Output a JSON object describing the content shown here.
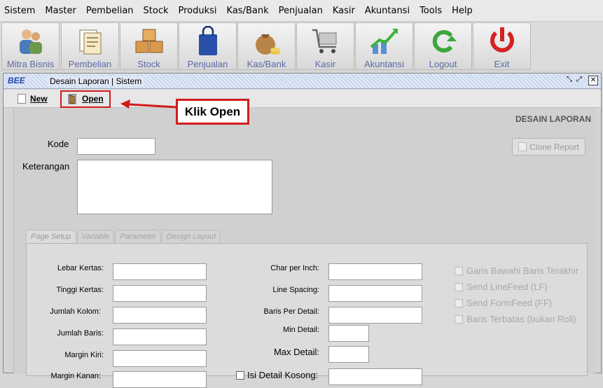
{
  "menubar": [
    "Sistem",
    "Master",
    "Pembelian",
    "Stock",
    "Produksi",
    "Kas/Bank",
    "Penjualan",
    "Kasir",
    "Akuntansi",
    "Tools",
    "Help"
  ],
  "toolbar": [
    {
      "label": "Mitra Bisnis",
      "icon": "people-icon"
    },
    {
      "label": "Pembelian",
      "icon": "documents-icon"
    },
    {
      "label": "Stock",
      "icon": "boxes-icon"
    },
    {
      "label": "Penjualan",
      "icon": "shopping-bag-icon"
    },
    {
      "label": "Kas/Bank",
      "icon": "money-bag-icon"
    },
    {
      "label": "Kasir",
      "icon": "cart-icon"
    },
    {
      "label": "Akuntansi",
      "icon": "chart-up-icon"
    },
    {
      "label": "Logout",
      "icon": "refresh-arrow-icon"
    },
    {
      "label": "Exit",
      "icon": "power-icon"
    }
  ],
  "window": {
    "logo": "BEE",
    "title": "Desain Laporan | Sistem"
  },
  "subbar": {
    "new_label": "New",
    "open_label": "Open"
  },
  "callout": "Klik Open",
  "panel": {
    "title": "DESAIN LAPORAN",
    "kode_label": "Kode",
    "keterangan_label": "Keterangan",
    "clone_label": "Clone Report"
  },
  "tabs": [
    "Page Setup",
    "Variable",
    "Parameter",
    "Design Layout"
  ],
  "page_setup": {
    "left_fields": [
      "Lebar Kertas:",
      "Tinggi Kertas:",
      "Jumlah Kolom:",
      "Jumlah Baris:",
      "Margin Kiri:",
      "Margin Kanan:"
    ],
    "right_fields": [
      "Char per Inch:",
      "Line Spacing:",
      "Baris Per Detail:",
      "Min Detail:",
      "Max Detail:",
      "Isi Detail Kosong:"
    ],
    "checkboxes": [
      "Garis Bawahi Baris Terakhir",
      "Send LineFeed (LF)",
      "Send FormFeed (FF)",
      "Baris Terbatas (bukan Roll)"
    ]
  },
  "colors": {
    "accent_red": "#d21b1b",
    "toolbar_label": "#5a6aa6"
  }
}
